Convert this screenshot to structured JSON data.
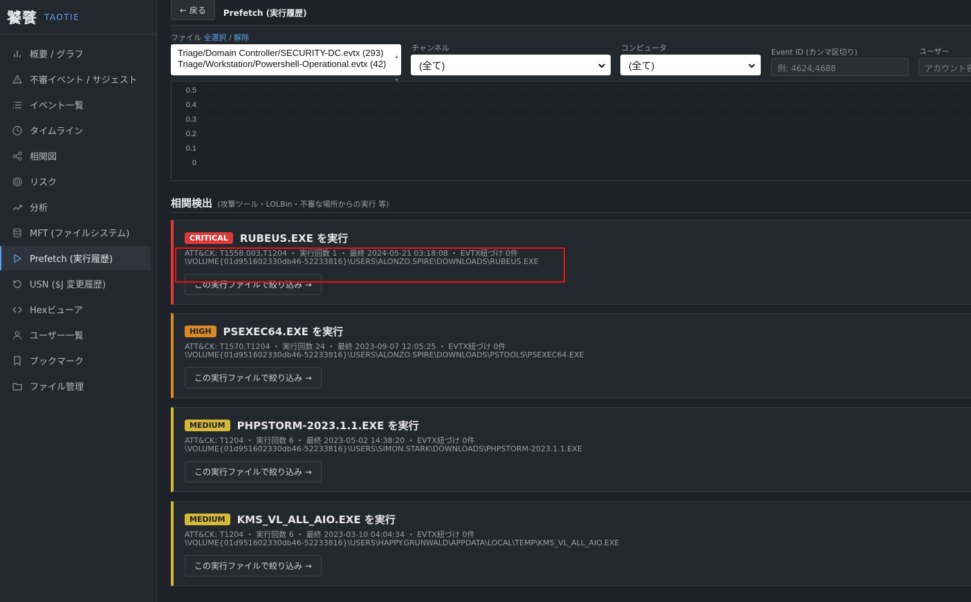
{
  "brand": {
    "name": "饕餮",
    "sub": "TAOTIE"
  },
  "sidebar": {
    "items": [
      {
        "label": "概要 / グラフ",
        "icon": "bar-chart-icon"
      },
      {
        "label": "不審イベント / サジェスト",
        "icon": "warning-icon"
      },
      {
        "label": "イベント一覧",
        "icon": "list-icon"
      },
      {
        "label": "タイムライン",
        "icon": "clock-icon"
      },
      {
        "label": "相関図",
        "icon": "share-icon"
      },
      {
        "label": "リスク",
        "icon": "target-icon"
      },
      {
        "label": "分析",
        "icon": "trend-icon"
      },
      {
        "label": "MFT (ファイルシステム)",
        "icon": "database-icon"
      },
      {
        "label": "Prefetch (実行履歴)",
        "icon": "play-icon",
        "active": true
      },
      {
        "label": "USN ($J 変更履歴)",
        "icon": "history-icon"
      },
      {
        "label": "Hexビューア",
        "icon": "code-icon"
      },
      {
        "label": "ユーザー一覧",
        "icon": "user-icon"
      },
      {
        "label": "ブックマーク",
        "icon": "bookmark-icon"
      },
      {
        "label": "ファイル管理",
        "icon": "folder-icon"
      }
    ]
  },
  "topbar": {
    "back_label": "← 戻る",
    "title": "Prefetch (実行履歴)"
  },
  "filters": {
    "file_label": "ファイル",
    "select_all": "全選択",
    "sep": "/",
    "deselect": "解除",
    "files": [
      "Triage/Domain Controller/SECURITY-DC.evtx (293)",
      "Triage/Workstation/Powershell-Operational.evtx (42)"
    ],
    "channel_label": "チャンネル",
    "channel_value": "(全て)",
    "computer_label": "コンピュータ",
    "computer_value": "(全て)",
    "eventid_label": "Event ID (カンマ区切り)",
    "eventid_placeholder": "例: 4624,4688",
    "user_label": "ユーザー",
    "user_placeholder": "アカウント名"
  },
  "chart_data": {
    "type": "bar",
    "y_ticks": [
      "0.5",
      "0.4",
      "0.3",
      "0.2",
      "0.1",
      "0"
    ],
    "ylim": [
      0,
      0.5
    ],
    "grid": true
  },
  "section": {
    "title": "相関検出",
    "subtitle": "(攻撃ツール・LOLBin・不審な場所からの実行 等)"
  },
  "colors": {
    "critical": "#d93a3a",
    "high": "#d98a28",
    "medium": "#d4b83a"
  },
  "cards": [
    {
      "severity": "CRITICAL",
      "level": "critical",
      "title": "RUBEUS.EXE を実行",
      "meta": "ATT&CK: T1558.003,T1204 ・ 実行回数 1 ・ 最終 2024-05-21 03:18:08 ・ EVTX紐づけ 0件",
      "path": "\\VOLUME{01d951602330db46-52233816}\\USERS\\ALONZO.SPIRE\\DOWNLOADS\\RUBEUS.EXE",
      "button": "この実行ファイルで絞り込み →"
    },
    {
      "severity": "HIGH",
      "level": "high",
      "title": "PSEXEC64.EXE を実行",
      "meta": "ATT&CK: T1570,T1204 ・ 実行回数 24 ・ 最終 2023-09-07 12:05:25 ・ EVTX紐づけ 0件",
      "path": "\\VOLUME{01d951602330db46-52233816}\\USERS\\ALONZO.SPIRE\\DOWNLOADS\\PSTOOLS\\PSEXEC64.EXE",
      "button": "この実行ファイルで絞り込み →"
    },
    {
      "severity": "MEDIUM",
      "level": "medium",
      "title": "PHPSTORM-2023.1.1.EXE を実行",
      "meta": "ATT&CK: T1204 ・ 実行回数 6 ・ 最終 2023-05-02 14:38:20 ・ EVTX紐づけ 0件",
      "path": "\\VOLUME{01d951602330db46-52233816}\\USERS\\SIMON.STARK\\DOWNLOADS\\PHPSTORM-2023.1.1.EXE",
      "button": "この実行ファイルで絞り込み →"
    },
    {
      "severity": "MEDIUM",
      "level": "medium",
      "title": "KMS_VL_ALL_AIO.EXE を実行",
      "meta": "ATT&CK: T1204 ・ 実行回数 6 ・ 最終 2023-03-10 04:04:34 ・ EVTX紐づけ 0件",
      "path": "\\VOLUME{01d951602330db46-52233816}\\USERS\\HAPPY.GRUNWALD\\APPDATA\\LOCAL\\TEMP\\KMS_VL_ALL_AIO.EXE",
      "button": "この実行ファイルで絞り込み →"
    }
  ]
}
